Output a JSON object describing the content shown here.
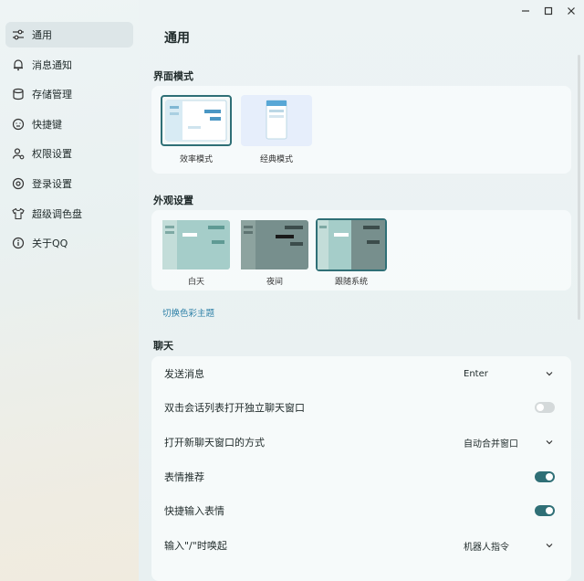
{
  "sidebar": {
    "items": [
      {
        "label": "通用",
        "icon": "sliders-icon",
        "active": true
      },
      {
        "label": "消息通知",
        "icon": "bell-icon"
      },
      {
        "label": "存储管理",
        "icon": "database-icon"
      },
      {
        "label": "快捷键",
        "icon": "keyboard-icon"
      },
      {
        "label": "权限设置",
        "icon": "user-shield-icon"
      },
      {
        "label": "登录设置",
        "icon": "gear-icon"
      },
      {
        "label": "超级调色盘",
        "icon": "shirt-icon"
      },
      {
        "label": "关于QQ",
        "icon": "info-icon"
      }
    ]
  },
  "main": {
    "title": "通用",
    "interface_mode": {
      "label": "界面模式",
      "options": [
        {
          "label": "效率模式",
          "selected": true
        },
        {
          "label": "经典模式",
          "selected": false
        }
      ]
    },
    "appearance": {
      "label": "外观设置",
      "options": [
        {
          "label": "白天",
          "selected": false
        },
        {
          "label": "夜间",
          "selected": false
        },
        {
          "label": "跟随系统",
          "selected": true
        }
      ],
      "theme_link": "切换色彩主题"
    },
    "chat": {
      "label": "聊天",
      "send_message": {
        "label": "发送消息",
        "value": "Enter"
      },
      "double_click_open": {
        "label": "双击会话列表打开独立聊天窗口",
        "on": false
      },
      "open_new_window": {
        "label": "打开新聊天窗口的方式",
        "value": "自动合并窗口"
      },
      "emoji_recommend": {
        "label": "表情推荐",
        "on": true
      },
      "quick_emoji": {
        "label": "快捷输入表情",
        "on": true
      },
      "slash_trigger": {
        "label": "输入\"/\"时唤起",
        "value": "机器人指令"
      }
    }
  },
  "colors": {
    "accent": "#2f6f76",
    "link": "#2b7fa6"
  }
}
